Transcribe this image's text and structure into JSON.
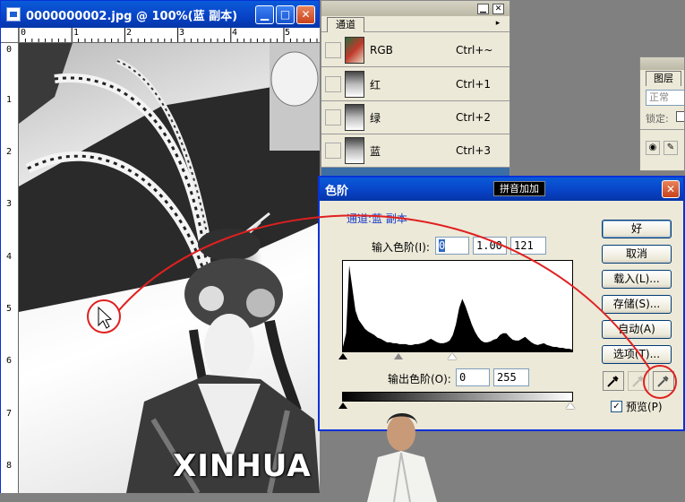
{
  "document": {
    "title": "0000000002.jpg @ 100%(蓝 副本)",
    "ruler_top": [
      "0",
      "1",
      "2",
      "3",
      "4",
      "5"
    ],
    "ruler_left": [
      "0",
      "1",
      "2",
      "3",
      "4",
      "5",
      "6",
      "7",
      "8"
    ],
    "watermark": "XINHUA"
  },
  "channels_panel": {
    "tab": "通道",
    "rows": [
      {
        "name": "RGB",
        "shortcut": "Ctrl+~"
      },
      {
        "name": "红",
        "shortcut": "Ctrl+1"
      },
      {
        "name": "绿",
        "shortcut": "Ctrl+2"
      },
      {
        "name": "蓝",
        "shortcut": "Ctrl+3"
      }
    ]
  },
  "layers_panel": {
    "tab": "图层",
    "blend_mode": "正常",
    "lock_label": "锁定:"
  },
  "levels_dialog": {
    "title": "色阶",
    "ime_indicator": "拼音加加",
    "channel": "通道:蓝 副本",
    "input_label": "输入色阶(I):",
    "input_black": "0",
    "input_gamma": "1.00",
    "input_white": "121",
    "output_label": "输出色阶(O):",
    "output_black": "0",
    "output_white": "255",
    "buttons": {
      "ok": "好",
      "cancel": "取消",
      "load": "载入(L)...",
      "save": "存储(S)...",
      "auto": "自动(A)",
      "options": "选项(T)..."
    },
    "preview_label": "预览(P)",
    "preview_checked": true,
    "histogram": [
      0.05,
      0.2,
      0.95,
      0.7,
      0.45,
      0.35,
      0.3,
      0.25,
      0.22,
      0.2,
      0.18,
      0.15,
      0.14,
      0.12,
      0.1,
      0.1,
      0.09,
      0.09,
      0.08,
      0.08,
      0.08,
      0.07,
      0.07,
      0.08,
      0.08,
      0.09,
      0.1,
      0.12,
      0.14,
      0.12,
      0.1,
      0.09,
      0.09,
      0.1,
      0.12,
      0.18,
      0.3,
      0.48,
      0.58,
      0.5,
      0.4,
      0.3,
      0.22,
      0.16,
      0.12,
      0.1,
      0.1,
      0.11,
      0.13,
      0.14,
      0.18,
      0.2,
      0.2,
      0.16,
      0.13,
      0.12,
      0.12,
      0.14,
      0.16,
      0.13,
      0.1,
      0.08,
      0.07,
      0.08,
      0.09,
      0.07,
      0.06,
      0.05,
      0.05,
      0.04,
      0.04,
      0.03,
      0.03,
      0.02
    ]
  },
  "colors": {
    "annotation": "#e02020",
    "xp_blue": "#0A5BD9",
    "selected_channel": "#3A6EA5"
  }
}
